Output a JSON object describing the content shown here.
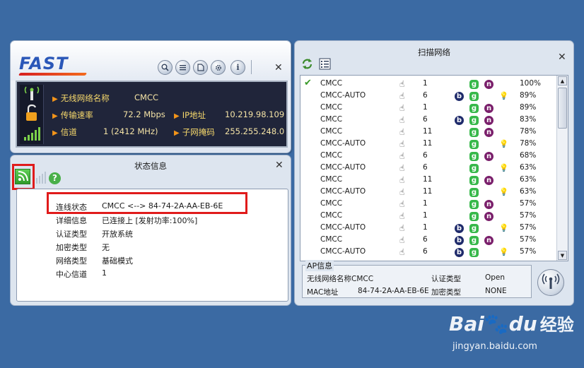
{
  "main": {
    "logo": "FAST",
    "rows": [
      {
        "label": "无线网络名称",
        "value": "CMCC"
      },
      {
        "label": "传输速率",
        "value": "72.2 Mbps"
      },
      {
        "label": "信道",
        "value": "1 (2412 MHz)"
      }
    ],
    "right_rows": [
      {
        "label": "IP地址",
        "value": "10.219.98.109"
      },
      {
        "label": "子网掩码",
        "value": "255.255.248.0"
      }
    ]
  },
  "status": {
    "title": "状态信息",
    "rows": [
      {
        "label": "连线状态",
        "value": "CMCC <--> 84-74-2A-AA-EB-6E"
      },
      {
        "label": "详细信息",
        "value": "已连接上 [发射功率:100%]"
      },
      {
        "label": "认证类型",
        "value": "开放系统"
      },
      {
        "label": "加密类型",
        "value": "无"
      },
      {
        "label": "网络类型",
        "value": "基础模式"
      },
      {
        "label": "中心信道",
        "value": "1"
      }
    ]
  },
  "scan": {
    "title": "扫描网络",
    "networks": [
      {
        "ssid": "CMCC",
        "ch": "1",
        "b": false,
        "g": true,
        "n": true,
        "wps": false,
        "signal": "100%",
        "connected": true
      },
      {
        "ssid": "CMCC-AUTO",
        "ch": "6",
        "b": true,
        "g": true,
        "n": false,
        "wps": true,
        "signal": "89%"
      },
      {
        "ssid": "CMCC",
        "ch": "1",
        "b": false,
        "g": true,
        "n": true,
        "wps": false,
        "signal": "89%"
      },
      {
        "ssid": "CMCC",
        "ch": "6",
        "b": true,
        "g": true,
        "n": true,
        "wps": false,
        "signal": "83%"
      },
      {
        "ssid": "CMCC",
        "ch": "11",
        "b": false,
        "g": true,
        "n": true,
        "wps": false,
        "signal": "78%"
      },
      {
        "ssid": "CMCC-AUTO",
        "ch": "11",
        "b": false,
        "g": true,
        "n": false,
        "wps": true,
        "signal": "78%"
      },
      {
        "ssid": "CMCC",
        "ch": "6",
        "b": false,
        "g": true,
        "n": true,
        "wps": false,
        "signal": "68%"
      },
      {
        "ssid": "CMCC-AUTO",
        "ch": "6",
        "b": false,
        "g": true,
        "n": false,
        "wps": true,
        "signal": "63%"
      },
      {
        "ssid": "CMCC",
        "ch": "11",
        "b": false,
        "g": true,
        "n": true,
        "wps": false,
        "signal": "63%"
      },
      {
        "ssid": "CMCC-AUTO",
        "ch": "11",
        "b": false,
        "g": true,
        "n": false,
        "wps": true,
        "signal": "63%"
      },
      {
        "ssid": "CMCC",
        "ch": "1",
        "b": false,
        "g": true,
        "n": true,
        "wps": false,
        "signal": "57%"
      },
      {
        "ssid": "CMCC",
        "ch": "1",
        "b": false,
        "g": true,
        "n": true,
        "wps": false,
        "signal": "57%"
      },
      {
        "ssid": "CMCC-AUTO",
        "ch": "1",
        "b": true,
        "g": true,
        "n": false,
        "wps": true,
        "signal": "57%"
      },
      {
        "ssid": "CMCC",
        "ch": "6",
        "b": true,
        "g": true,
        "n": true,
        "wps": false,
        "signal": "57%"
      },
      {
        "ssid": "CMCC-AUTO",
        "ch": "6",
        "b": true,
        "g": true,
        "n": false,
        "wps": true,
        "signal": "57%"
      }
    ],
    "ap": {
      "legend": "AP信息",
      "ssid_label": "无线网络名称",
      "ssid": "CMCC",
      "auth_label": "认证类型",
      "auth": "Open",
      "mac_label": "MAC地址",
      "mac": "84-74-2A-AA-EB-6E",
      "enc_label": "加密类型",
      "enc": "NONE"
    }
  },
  "watermark": {
    "brand": "Bai",
    "brand2": "du",
    "cn": "经验",
    "url": "jingyan.baidu.com"
  },
  "colors": {
    "accent_red": "#e01b1b",
    "desktop": "#3b6aa3",
    "panel_dark": "#20253a"
  }
}
